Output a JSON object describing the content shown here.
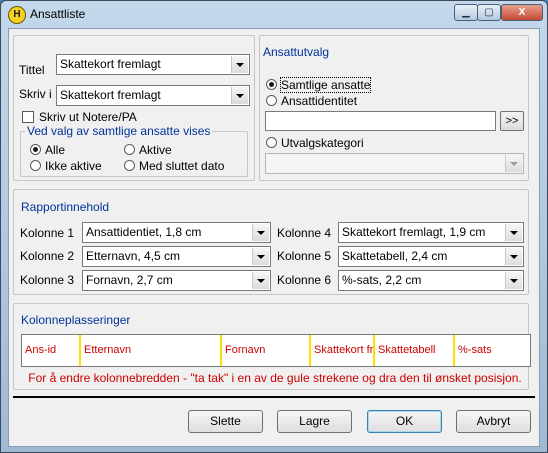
{
  "window": {
    "title": "Ansattliste",
    "app_icon": "H",
    "min_glyph": "▁",
    "max_glyph": "▢",
    "close_glyph": "X"
  },
  "left_top": {
    "tittel_label": "Tittel",
    "tittel_value": "Skattekort fremlagt",
    "skriv_label": "Skriv i",
    "skriv_value": "Skattekort fremlagt",
    "notes_check_label": "Skriv ut Notere/PA",
    "subgroup_title": "Ved valg av samtlige ansatte vises",
    "radios": {
      "alle": "Alle",
      "aktive": "Aktive",
      "ikke_aktive": "Ikke aktive",
      "sluttet": "Med sluttet dato"
    }
  },
  "ansattutvalg": {
    "title": "Ansattutvalg",
    "samtlige": "Samtlige ansatte",
    "ansattidentitet": "Ansattidentitet",
    "browse_label": ">>",
    "utvalgskategori": "Utvalgskategori",
    "kategori_value": ""
  },
  "rapport": {
    "title": "Rapportinnehold",
    "kol1_label": "Kolonne 1",
    "kol1_value": "Ansattidentiet, 1,8 cm",
    "kol2_label": "Kolonne 2",
    "kol2_value": "Etternavn, 4,5 cm",
    "kol3_label": "Kolonne 3",
    "kol3_value": "Fornavn, 2,7 cm",
    "kol4_label": "Kolonne 4",
    "kol4_value": "Skattekort fremlagt, 1,9 cm",
    "kol5_label": "Kolonne 5",
    "kol5_value": "Skattetabell, 2,4 cm",
    "kol6_label": "Kolonne 6",
    "kol6_value": "%-sats, 2,2 cm"
  },
  "plassering": {
    "title": "Kolonneplasseringer",
    "columns": [
      "Ans-id",
      "Etternavn",
      "Fornavn",
      "Skattekort fr",
      "Skattetabell",
      "%-sats"
    ],
    "hint": "For å endre kolonnebredden - \"ta tak\" i en av de gule strekene og dra den til ønsket posisjon."
  },
  "buttons": {
    "slette": "Slette",
    "lagre": "Lagre",
    "ok": "OK",
    "avbryt": "Avbryt"
  },
  "colors": {
    "divider": "#ffe000",
    "column_text": "#cc0000",
    "group_title": "#003399"
  }
}
